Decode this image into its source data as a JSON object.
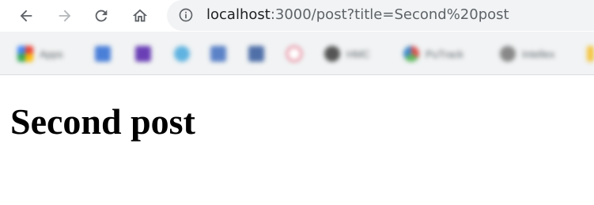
{
  "browser": {
    "url_host": "localhost",
    "url_rest": ":3000/post?title=Second%20post",
    "icons": {
      "back": "back-arrow-icon",
      "forward": "forward-arrow-icon",
      "reload": "reload-icon",
      "home": "home-icon",
      "info": "info-icon"
    }
  },
  "bookmarks": [
    {
      "label": "Apps",
      "icon": "apps-grid-icon",
      "color": "#f4b400"
    },
    {
      "label": "",
      "icon": "bookmark-icon",
      "color": "#4a7fd8"
    },
    {
      "label": "",
      "icon": "bookmark-icon",
      "color": "#6a3fb5"
    },
    {
      "label": "",
      "icon": "bookmark-icon",
      "color": "#5fb3e0"
    },
    {
      "label": "",
      "icon": "bookmark-icon",
      "color": "#5b82c7"
    },
    {
      "label": "",
      "icon": "bookmark-icon",
      "color": "#4f6fa8"
    },
    {
      "label": "",
      "icon": "bookmark-icon",
      "color": "#e0607a"
    },
    {
      "label": "HMC",
      "icon": "bookmark-icon",
      "color": "#555555"
    },
    {
      "label": "PuTrack",
      "icon": "bookmark-icon",
      "color": "#d9534f"
    },
    {
      "label": "Intellex",
      "icon": "bookmark-icon",
      "color": "#888888"
    }
  ],
  "page": {
    "heading": "Second post"
  }
}
